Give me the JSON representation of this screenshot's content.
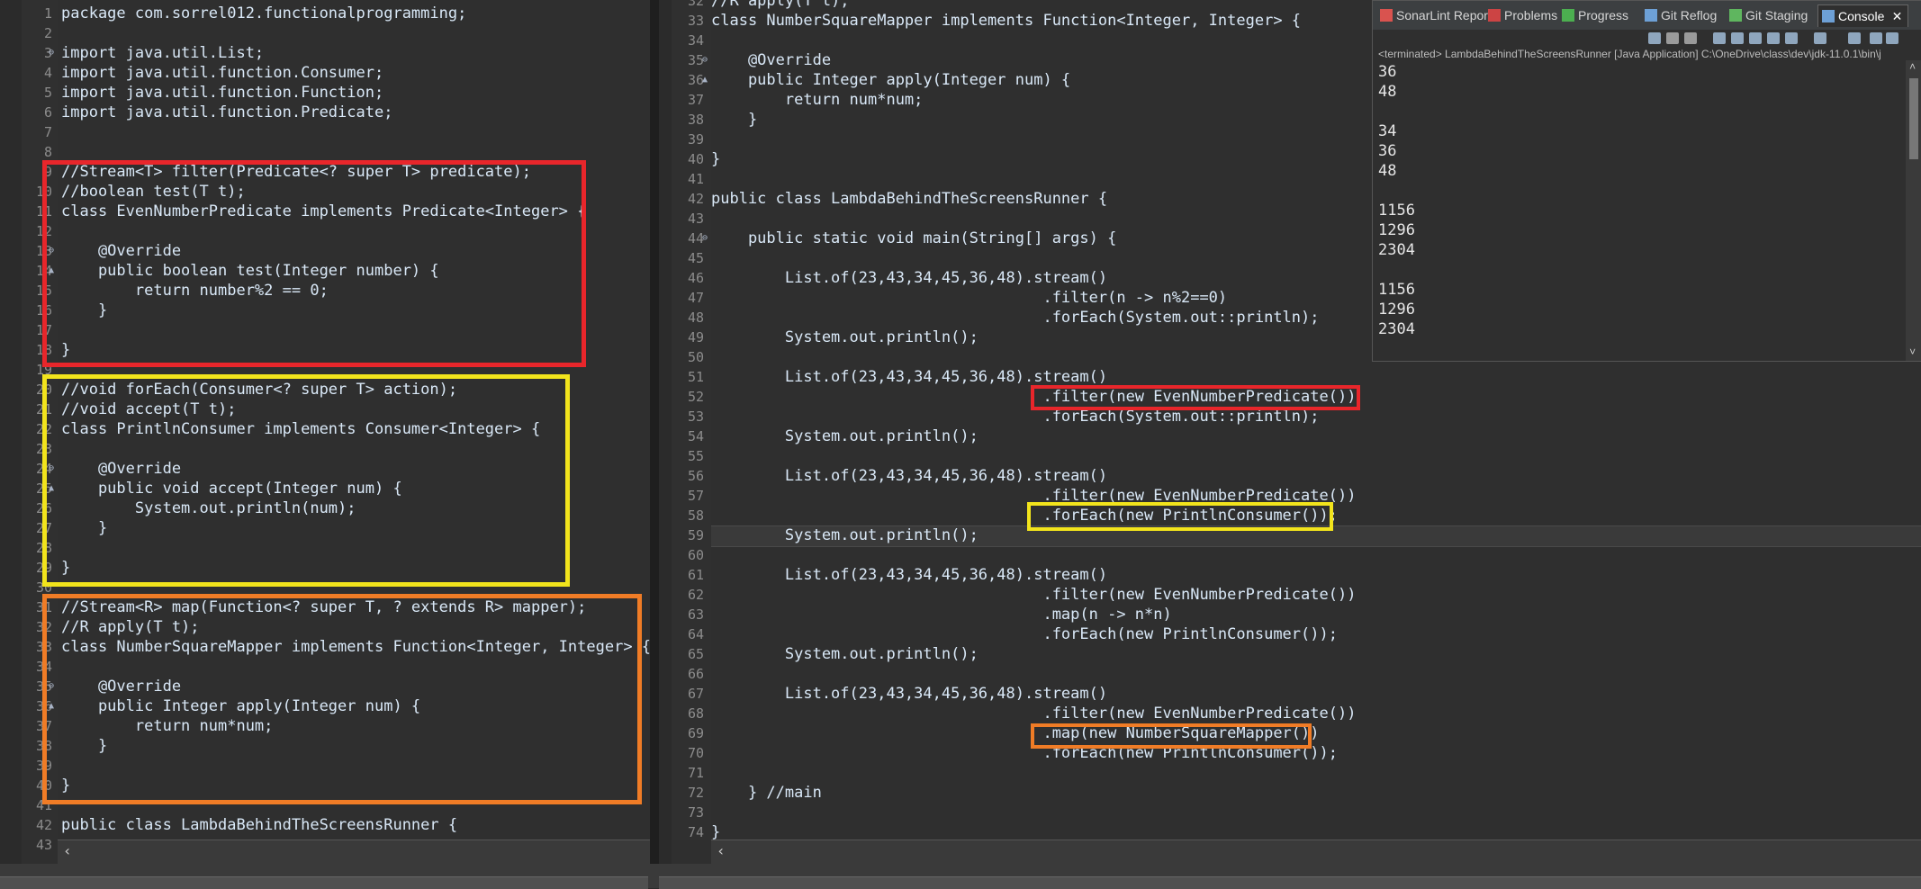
{
  "left_editor": {
    "lines": [
      {
        "n": "1",
        "t": "package com.sorrel012.functionalprogramming;"
      },
      {
        "n": "2",
        "t": ""
      },
      {
        "n": "3",
        "t": "import java.util.List;",
        "m": "⊖"
      },
      {
        "n": "4",
        "t": "import java.util.function.Consumer;"
      },
      {
        "n": "5",
        "t": "import java.util.function.Function;"
      },
      {
        "n": "6",
        "t": "import java.util.function.Predicate;"
      },
      {
        "n": "7",
        "t": ""
      },
      {
        "n": "8",
        "t": ""
      },
      {
        "n": "9",
        "t": "//Stream<T> filter(Predicate<? super T> predicate);"
      },
      {
        "n": "10",
        "t": "//boolean test(T t);"
      },
      {
        "n": "11",
        "t": "class EvenNumberPredicate implements Predicate<Integer> {"
      },
      {
        "n": "12",
        "t": ""
      },
      {
        "n": "13",
        "t": "    @Override",
        "m": "⊖"
      },
      {
        "n": "14",
        "t": "    public boolean test(Integer number) {",
        "m": "▲"
      },
      {
        "n": "15",
        "t": "        return number%2 == 0;"
      },
      {
        "n": "16",
        "t": "    }"
      },
      {
        "n": "17",
        "t": ""
      },
      {
        "n": "18",
        "t": "}"
      },
      {
        "n": "19",
        "t": ""
      },
      {
        "n": "20",
        "t": "//void forEach(Consumer<? super T> action);"
      },
      {
        "n": "21",
        "t": "//void accept(T t);"
      },
      {
        "n": "22",
        "t": "class PrintlnConsumer implements Consumer<Integer> {"
      },
      {
        "n": "23",
        "t": ""
      },
      {
        "n": "24",
        "t": "    @Override",
        "m": "⊖"
      },
      {
        "n": "25",
        "t": "    public void accept(Integer num) {",
        "m": "▲"
      },
      {
        "n": "26",
        "t": "        System.out.println(num);"
      },
      {
        "n": "27",
        "t": "    }"
      },
      {
        "n": "28",
        "t": ""
      },
      {
        "n": "29",
        "t": "}"
      },
      {
        "n": "30",
        "t": ""
      },
      {
        "n": "31",
        "t": "//Stream<R> map(Function<? super T, ? extends R> mapper);"
      },
      {
        "n": "32",
        "t": "//R apply(T t);"
      },
      {
        "n": "33",
        "t": "class NumberSquareMapper implements Function<Integer, Integer> {"
      },
      {
        "n": "34",
        "t": ""
      },
      {
        "n": "35",
        "t": "    @Override",
        "m": "⊖"
      },
      {
        "n": "36",
        "t": "    public Integer apply(Integer num) {",
        "m": "▲"
      },
      {
        "n": "37",
        "t": "        return num*num;"
      },
      {
        "n": "38",
        "t": "    }"
      },
      {
        "n": "39",
        "t": ""
      },
      {
        "n": "40",
        "t": "}"
      },
      {
        "n": "41",
        "t": ""
      },
      {
        "n": "42",
        "t": "public class LambdaBehindTheScreensRunner {"
      },
      {
        "n": "43",
        "t": ""
      }
    ]
  },
  "right_editor": {
    "lines": [
      {
        "n": "32",
        "t": "//R apply(T t);"
      },
      {
        "n": "33",
        "t": "class NumberSquareMapper implements Function<Integer, Integer> {"
      },
      {
        "n": "34",
        "t": ""
      },
      {
        "n": "35",
        "t": "    @Override",
        "m": "⊖"
      },
      {
        "n": "36",
        "t": "    public Integer apply(Integer num) {",
        "m": "▲"
      },
      {
        "n": "37",
        "t": "        return num*num;"
      },
      {
        "n": "38",
        "t": "    }"
      },
      {
        "n": "39",
        "t": ""
      },
      {
        "n": "40",
        "t": "}"
      },
      {
        "n": "41",
        "t": ""
      },
      {
        "n": "42",
        "t": "public class LambdaBehindTheScreensRunner {"
      },
      {
        "n": "43",
        "t": ""
      },
      {
        "n": "44",
        "t": "    public static void main(String[] args) {",
        "m": "⊖"
      },
      {
        "n": "45",
        "t": ""
      },
      {
        "n": "46",
        "t": "        List.of(23,43,34,45,36,48).stream()"
      },
      {
        "n": "47",
        "t": "                                    .filter(n -> n%2==0)"
      },
      {
        "n": "48",
        "t": "                                    .forEach(System.out::println);"
      },
      {
        "n": "49",
        "t": "        System.out.println();"
      },
      {
        "n": "50",
        "t": ""
      },
      {
        "n": "51",
        "t": "        List.of(23,43,34,45,36,48).stream()"
      },
      {
        "n": "52",
        "t": "                                    .filter(new EvenNumberPredicate())"
      },
      {
        "n": "53",
        "t": "                                    .forEach(System.out::println);"
      },
      {
        "n": "54",
        "t": "        System.out.println();"
      },
      {
        "n": "55",
        "t": ""
      },
      {
        "n": "56",
        "t": "        List.of(23,43,34,45,36,48).stream()"
      },
      {
        "n": "57",
        "t": "                                    .filter(new EvenNumberPredicate())"
      },
      {
        "n": "58",
        "t": "                                    .forEach(new PrintlnConsumer());"
      },
      {
        "n": "59",
        "t": "        System.out.println();"
      },
      {
        "n": "60",
        "t": ""
      },
      {
        "n": "61",
        "t": "        List.of(23,43,34,45,36,48).stream()"
      },
      {
        "n": "62",
        "t": "                                    .filter(new EvenNumberPredicate())"
      },
      {
        "n": "63",
        "t": "                                    .map(n -> n*n)"
      },
      {
        "n": "64",
        "t": "                                    .forEach(new PrintlnConsumer());"
      },
      {
        "n": "65",
        "t": "        System.out.println();"
      },
      {
        "n": "66",
        "t": ""
      },
      {
        "n": "67",
        "t": "        List.of(23,43,34,45,36,48).stream()"
      },
      {
        "n": "68",
        "t": "                                    .filter(new EvenNumberPredicate())"
      },
      {
        "n": "69",
        "t": "                                    .map(new NumberSquareMapper())"
      },
      {
        "n": "70",
        "t": "                                    .forEach(new PrintlnConsumer());"
      },
      {
        "n": "71",
        "t": ""
      },
      {
        "n": "72",
        "t": "    } //main"
      },
      {
        "n": "73",
        "t": ""
      },
      {
        "n": "74",
        "t": "}"
      }
    ]
  },
  "console": {
    "tabs": [
      {
        "label": "SonarLint Report",
        "icon": "sonarlint-icon"
      },
      {
        "label": "Problems",
        "icon": "problems-icon"
      },
      {
        "label": "Progress",
        "icon": "progress-icon"
      },
      {
        "label": "Git Reflog",
        "icon": "git-reflog-icon"
      },
      {
        "label": "Git Staging",
        "icon": "git-staging-icon"
      },
      {
        "label": "Console",
        "icon": "console-icon",
        "active": true
      }
    ],
    "terminated_text": "<terminated> LambdaBehindTheScreensRunner [Java Application] C:\\OneDrive\\class\\dev\\jdk-11.0.1\\bin\\j",
    "output": [
      "36",
      "48",
      "",
      "34",
      "36",
      "48",
      "",
      "1156",
      "1296",
      "2304",
      "",
      "1156",
      "1296",
      "2304"
    ]
  },
  "colors": {
    "box_red": "#e8262b",
    "box_yellow": "#f2e41c",
    "box_orange": "#f07c26",
    "editor_bg": "#2f2f2f"
  }
}
